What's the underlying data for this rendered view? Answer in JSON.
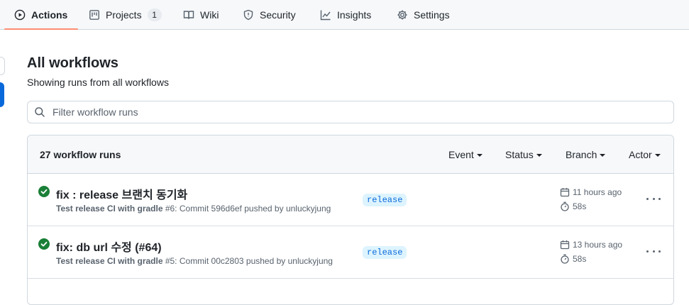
{
  "nav": {
    "tabs": [
      {
        "label": "Actions",
        "icon": "play-icon",
        "active": true
      },
      {
        "label": "Projects",
        "icon": "project-icon",
        "count": "1"
      },
      {
        "label": "Wiki",
        "icon": "book-icon"
      },
      {
        "label": "Security",
        "icon": "shield-icon"
      },
      {
        "label": "Insights",
        "icon": "graph-icon"
      },
      {
        "label": "Settings",
        "icon": "gear-icon"
      }
    ]
  },
  "main": {
    "title": "All workflows",
    "subtitle": "Showing runs from all workflows",
    "search": {
      "placeholder": "Filter workflow runs",
      "value": ""
    }
  },
  "runs_header": {
    "count_label": "27 workflow runs",
    "filters": [
      "Event",
      "Status",
      "Branch",
      "Actor"
    ]
  },
  "runs": [
    {
      "title": "fix : release 브랜치 동기화",
      "workflow": "Test release CI with gradle",
      "details": " #6: Commit 596d6ef pushed by unluckyjung",
      "branch": "release",
      "time_ago": "11 hours ago",
      "duration": "58s",
      "status": "success"
    },
    {
      "title": "fix: db url 수정 (#64)",
      "workflow": "Test release CI with gradle",
      "details": " #5: Commit 00c2803 pushed by unluckyjung",
      "branch": "release",
      "time_ago": "13 hours ago",
      "duration": "58s",
      "status": "success"
    }
  ],
  "colors": {
    "accent_underline": "#fd8c73",
    "success": "#1a7f37",
    "link_blue": "#0969da",
    "branch_bg": "#ddf4ff"
  }
}
